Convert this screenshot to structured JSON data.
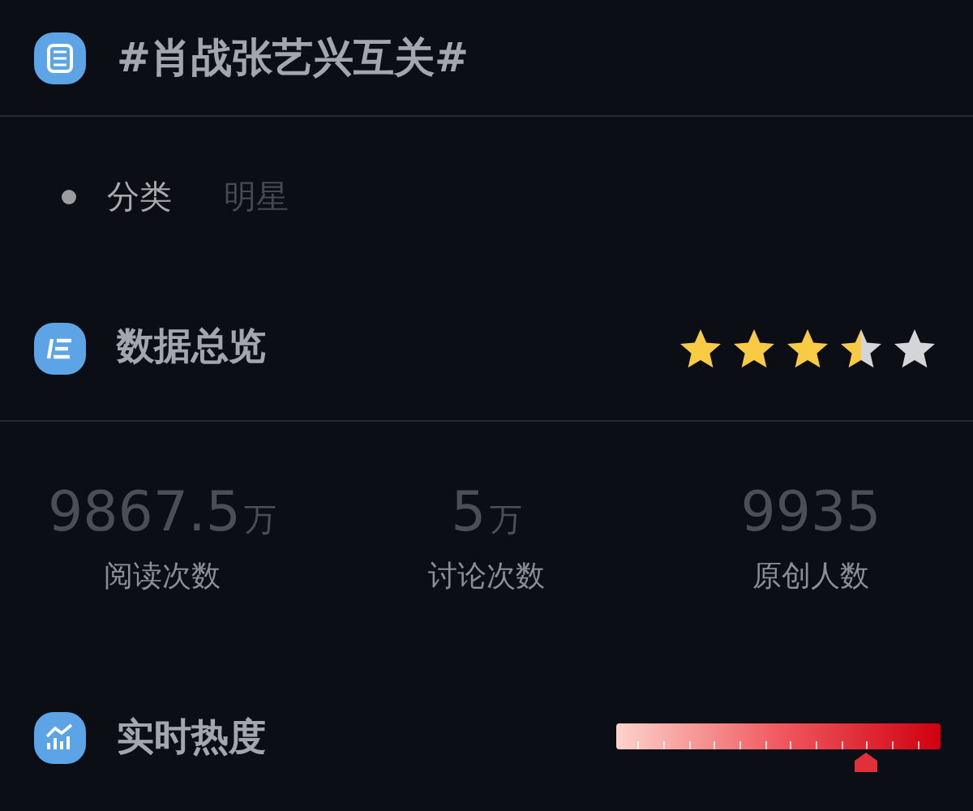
{
  "topic": {
    "title": "#肖战张艺兴互关#"
  },
  "category": {
    "label": "分类",
    "value": "明星"
  },
  "overview": {
    "title": "数据总览",
    "stars": 3.5
  },
  "stats": [
    {
      "number": "9867.5",
      "unit": "万",
      "label": "阅读次数"
    },
    {
      "number": "5",
      "unit": "万",
      "label": "讨论次数"
    },
    {
      "number": "9935",
      "label": "原创人数"
    }
  ],
  "heat": {
    "title": "实时热度",
    "level": 0.77
  }
}
